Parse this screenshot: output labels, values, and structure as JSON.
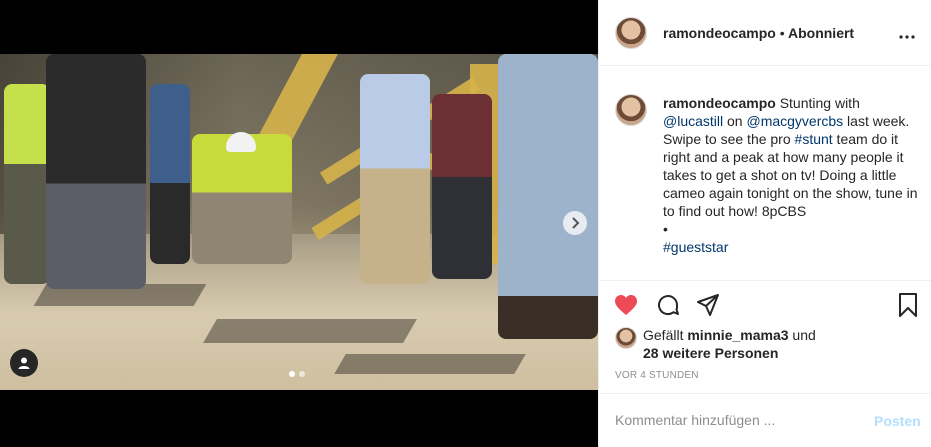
{
  "post": {
    "username": "ramondeocampo",
    "separator": "•",
    "follow_status": "Abonniert",
    "more_icon": "more-horizontal-icon"
  },
  "caption": {
    "username": "ramondeocampo",
    "part1": " Stunting with ",
    "mention1": "@lucastill",
    "part2": " on ",
    "mention2": "@macgyvercbs",
    "part3": " last week. Swipe to see the pro ",
    "hashtag1": "#stunt",
    "part4": " team do it right and a peak at how many people it takes to get a shot on tv! Doing a little cameo again tonight on the show, tune in to find out how! 8pCBS",
    "bullet": "•",
    "hashtag2": "#gueststar"
  },
  "actions": {
    "like_icon": "heart-icon",
    "comment_icon": "comment-icon",
    "share_icon": "send-icon",
    "save_icon": "bookmark-icon",
    "liked_color": "#ed4956"
  },
  "likes": {
    "prefix": "Gefällt ",
    "liker": "minnie_mama3",
    "suffix": " und",
    "others": "28 weitere Personen"
  },
  "timestamp": "VOR 4 STUNDEN",
  "comment": {
    "placeholder": "Kommentar hinzufügen ...",
    "post_label": "Posten"
  },
  "media": {
    "carousel_total": 2,
    "carousel_current": 1
  }
}
